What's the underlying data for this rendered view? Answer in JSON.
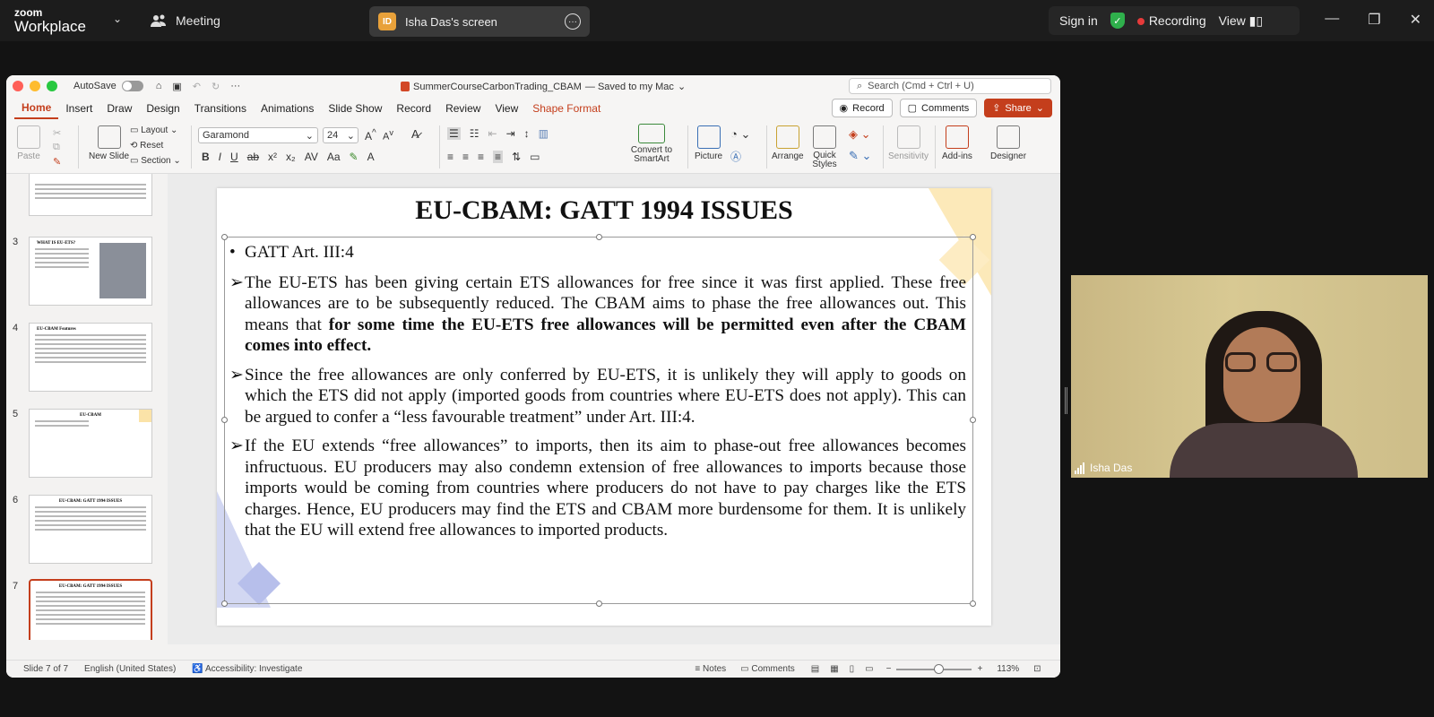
{
  "zoom": {
    "logo_line1": "zoom",
    "logo_line2": "Workplace",
    "meeting_label": "Meeting",
    "share_badge": "ID",
    "share_label": "Isha Das's screen",
    "sign_in": "Sign in",
    "recording": "Recording",
    "view": "View"
  },
  "ppt": {
    "autosave": "AutoSave",
    "doc_title": "SummerCourseCarbonTrading_CBAM",
    "doc_status": "— Saved to my Mac",
    "search_placeholder": "Search (Cmd + Ctrl + U)",
    "menu": [
      "Home",
      "Insert",
      "Draw",
      "Design",
      "Transitions",
      "Animations",
      "Slide Show",
      "Record",
      "Review",
      "View",
      "Shape Format"
    ],
    "record_btn": "Record",
    "comments_btn": "Comments",
    "share_btn": "Share",
    "ribbon": {
      "paste": "Paste",
      "new_slide": "New Slide",
      "layout": "Layout",
      "reset": "Reset",
      "section": "Section",
      "font": "Garamond",
      "size": "24",
      "convert": "Convert to SmartArt",
      "picture": "Picture",
      "arrange": "Arrange",
      "quick_styles": "Quick Styles",
      "sensitivity": "Sensitivity",
      "addins": "Add-ins",
      "designer": "Designer"
    }
  },
  "thumbs": [
    {
      "num": "3",
      "title": "WHAT IS EU-ETS?"
    },
    {
      "num": "4",
      "title": "EU-CBAM Features"
    },
    {
      "num": "5",
      "title": "EU-CBAM"
    },
    {
      "num": "6",
      "title": "EU-CBAM: GATT 1994 ISSUES"
    },
    {
      "num": "7",
      "title": "EU-CBAM: GATT 1994 ISSUES"
    }
  ],
  "slide": {
    "title": "EU-CBAM: GATT 1994 ISSUES",
    "bullet1": "GATT Art. III:4",
    "p1_normal": "The EU-ETS has been giving certain ETS allowances for free since it was first applied. These free allowances are to be subsequently reduced. The CBAM aims to phase the free allowances out. This means that ",
    "p1_bold": "for some time the EU-ETS free allowances will be permitted even after the CBAM comes into effect.",
    "p2": "Since the free allowances are only conferred by EU-ETS, it is unlikely they will apply to goods on which the ETS did not apply (imported goods from countries where EU-ETS does not apply). This can be argued to confer a “less favourable treatment” under Art. III:4.",
    "p3": "If the EU extends “free allowances” to imports, then its aim to phase-out free allowances becomes infructuous. EU producers may also condemn extension of free allowances to imports because those imports would be coming from countries where producers do not have to pay charges like the ETS charges. Hence, EU producers may find the ETS and CBAM more burdensome for them. It is unlikely that the EU will extend free allowances to imported products."
  },
  "status": {
    "slide_info": "Slide 7 of 7",
    "language": "English (United States)",
    "accessibility": "Accessibility: Investigate",
    "notes": "Notes",
    "comments": "Comments",
    "zoom_level": "113%"
  },
  "video": {
    "name": "Isha Das"
  }
}
